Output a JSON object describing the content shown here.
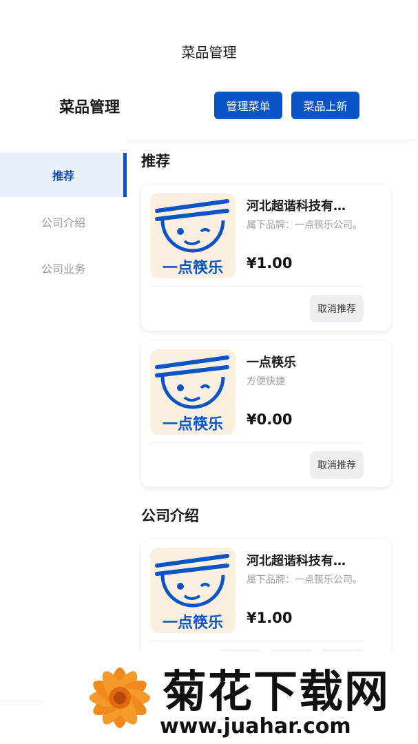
{
  "app": {
    "title": "菜品管理"
  },
  "header": {
    "title": "菜品管理",
    "manage_label": "管理菜单",
    "new_label": "菜品上新"
  },
  "sidebar": {
    "items": [
      {
        "label": "推荐",
        "active": true
      },
      {
        "label": "公司介绍",
        "active": false
      },
      {
        "label": "公司业务",
        "active": false
      }
    ]
  },
  "sections": [
    {
      "title": "推荐",
      "items": [
        {
          "name": "河北超谐科技有…",
          "desc": "属下品牌：一点筷乐公司。",
          "price": "¥1.00",
          "action": "取消推荐"
        },
        {
          "name": "一点筷乐",
          "desc": "方便快捷",
          "price": "¥0.00",
          "action": "取消推荐"
        }
      ]
    },
    {
      "title": "公司介绍",
      "items": [
        {
          "name": "河北超谐科技有…",
          "desc": "属下品牌：一点筷乐公司。",
          "price": "¥1.00"
        }
      ]
    }
  ],
  "logo": {
    "text": "一点筷乐",
    "icon": "chopsticks-face-logo",
    "bg_color": "#fbf0e0",
    "brand_color": "#0b54c8"
  },
  "watermark": {
    "title": "菊花下载网",
    "url": "www.juahar.com",
    "icon": "orange-flower-icon"
  },
  "colors": {
    "accent": "#0b54c8",
    "active_bg": "#eaf1fd"
  }
}
